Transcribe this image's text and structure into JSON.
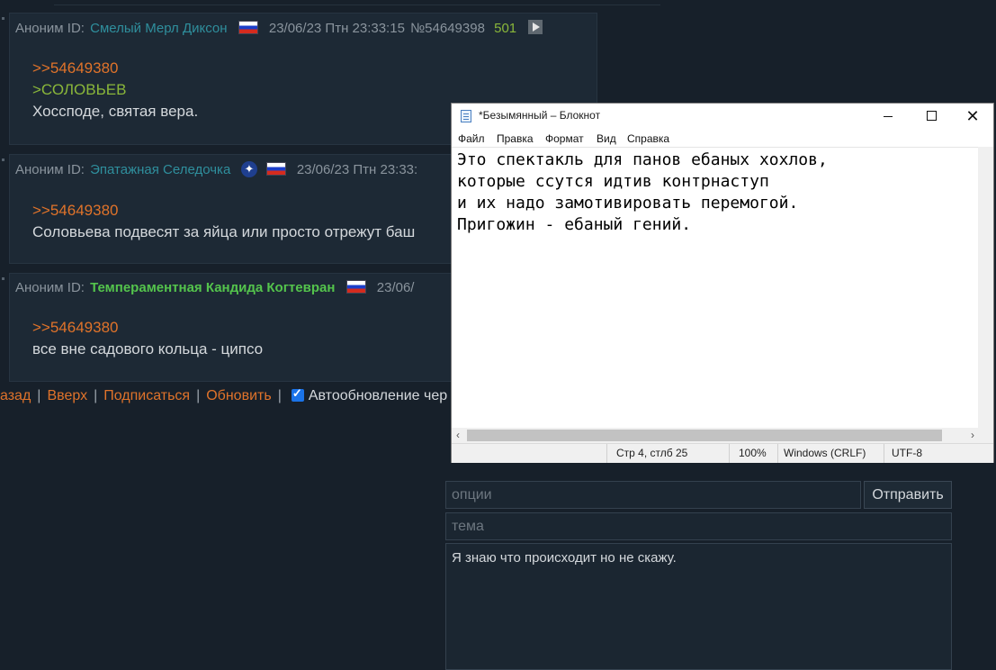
{
  "posts": [
    {
      "anon": "Аноним ID:",
      "name": "Смелый Мерл Диксон",
      "datetime": "23/06/23 Птн 23:33:15",
      "number": "№54649398",
      "replies": "501",
      "reply_ref": ">>54649380",
      "greentext": ">СОЛОВЬЕВ",
      "message": "Хоссподе, святая вера."
    },
    {
      "anon": "Аноним ID:",
      "name": "Эпатажная Селедочка",
      "datetime": "23/06/23 Птн 23:33:",
      "reply_ref": ">>54649380",
      "message": "Соловьева подвесят за яйца или просто отрежут баш"
    },
    {
      "anon": "Аноним ID:",
      "name": "Темпераментная Кандида Когтевран",
      "datetime": "23/06/",
      "reply_ref": ">>54649380",
      "message": "все вне садового кольца - ципсо"
    }
  ],
  "nav": {
    "back": "азад",
    "top": "Вверх",
    "subscribe": "Подписаться",
    "refresh": "Обновить",
    "auto_update": "Автообновление чер"
  },
  "form": {
    "options_placeholder": "опции",
    "submit": "Отправить",
    "subject_placeholder": "тема",
    "comment": "Я знаю что происходит но не скажу."
  },
  "notepad": {
    "title": "*Безымянный – Блокнот",
    "menu": [
      "Файл",
      "Правка",
      "Формат",
      "Вид",
      "Справка"
    ],
    "text": "Это спектакль для панов ебаных хохлов,\nкоторые ссутся идтив контрнаступ\nи их надо замотивировать перемогой.\nПригожин - ебаный гений.",
    "status": {
      "position": "Стр 4, стлб 25",
      "zoom": "100%",
      "line_endings": "Windows (CRLF)",
      "encoding": "UTF-8"
    }
  },
  "colors": {
    "background": "#17202a",
    "post_bg": "#1d2935",
    "reply_link": "#e0732a",
    "greentext": "#8ab73a",
    "name_teal": "#2f8f9d",
    "name_green": "#54c44c",
    "checkbox": "#1a73e8"
  },
  "flags": {
    "country": "russia-flag-icon",
    "extra": "nato-icon"
  }
}
